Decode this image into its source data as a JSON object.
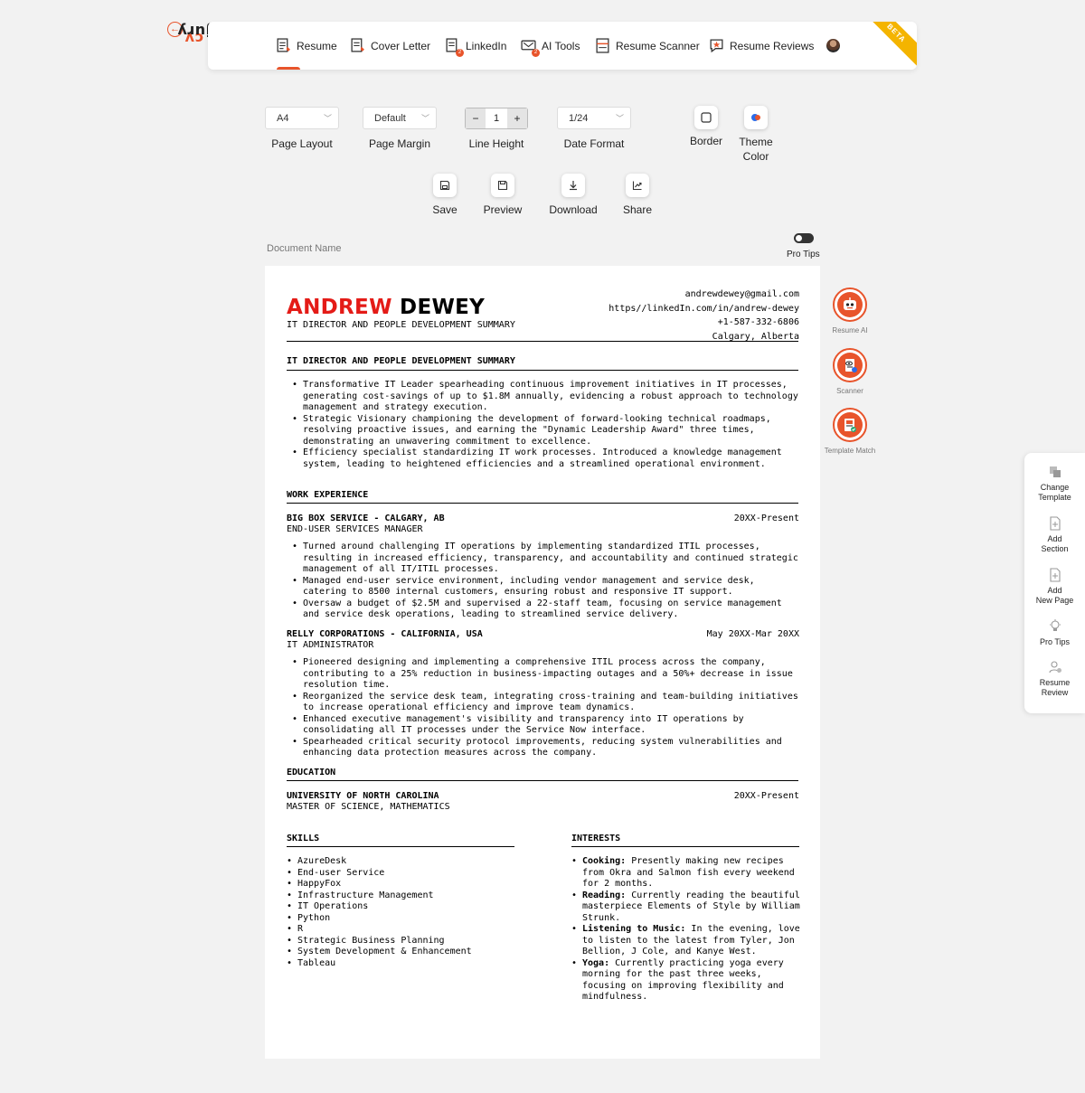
{
  "brand": {
    "cv": "cv",
    "jury": "jury",
    "accent": "#e8542b"
  },
  "nav": {
    "items": [
      {
        "label": "Resume",
        "icon": "resume-doc-icon"
      },
      {
        "label": "Cover Letter",
        "icon": "cover-letter-icon"
      },
      {
        "label": "LinkedIn",
        "icon": "linkedin-doc-icon",
        "badge": "2"
      },
      {
        "label": "AI Tools",
        "icon": "ai-tools-icon",
        "badge": "2"
      },
      {
        "label": "Resume Scanner",
        "icon": "scanner-icon"
      },
      {
        "label": "Resume Reviews",
        "icon": "review-star-icon"
      }
    ],
    "beta": "BETA"
  },
  "toolbar": {
    "page_layout": {
      "value": "A4",
      "label": "Page Layout"
    },
    "page_margin": {
      "value": "Default",
      "label": "Page Margin"
    },
    "line_height": {
      "value": "1",
      "minus": "−",
      "plus": "+",
      "label": "Line Height"
    },
    "date_format": {
      "value": "1/24",
      "label": "Date Format"
    },
    "border_label": "Border",
    "theme_label_1": "Theme",
    "theme_label_2": "Color",
    "save_label": "Save",
    "preview_label": "Preview",
    "download_label": "Download",
    "share_label": "Share"
  },
  "document_name_label": "Document Name",
  "pro_tips_toggle_label": "Pro Tips",
  "resume": {
    "first_name": "ANDREW",
    "last_name": "DEWEY",
    "subtitle": "IT DIRECTOR AND PEOPLE DEVELOPMENT SUMMARY",
    "contact": {
      "email": "andrewdewey@gmail.com",
      "linkedin": "https//linkedIn.com/in/andrew-dewey",
      "phone": "+1-587-332-6806",
      "location": "Calgary, Alberta"
    },
    "summary_title": "IT DIRECTOR AND PEOPLE DEVELOPMENT SUMMARY",
    "summary": [
      "Transformative IT Leader spearheading continuous improvement initiatives in IT processes, generating cost-savings of up to $1.8M annually, evidencing a robust approach to technology management and strategy execution.",
      "Strategic Visionary championing the development of forward-looking technical roadmaps, resolving proactive issues, and earning the \"Dynamic Leadership Award\" three times, demonstrating an unwavering commitment to excellence.",
      "Efficiency specialist standardizing IT work processes. Introduced a knowledge management system, leading to heightened efficiencies and a streamlined operational environment."
    ],
    "work_title": "WORK EXPERIENCE",
    "jobs": [
      {
        "company": "BIG BOX SERVICE - CALGARY, AB",
        "date": "20XX-Present",
        "role": "END-USER SERVICES MANAGER",
        "bullets": [
          "Turned around challenging IT operations by implementing standardized ITIL processes, resulting in increased efficiency, transparency, and accountability and continued strategic management of all IT/ITIL processes.",
          "Managed end-user service environment, including vendor management and service desk, catering to 8500 internal customers, ensuring robust and responsive IT support.",
          "Oversaw a budget of $2.5M and supervised a 22-staff team, focusing on service management and service desk operations, leading to streamlined service delivery."
        ]
      },
      {
        "company": "RELLY CORPORATIONS - CALIFORNIA, USA",
        "date": "May 20XX-Mar 20XX",
        "role": "IT ADMINISTRATOR",
        "bullets": [
          "Pioneered designing and implementing a comprehensive ITIL process across the company, contributing to a 25% reduction in business-impacting outages and a 50%+ decrease in issue resolution time.",
          "Reorganized the service desk team, integrating cross-training and team-building initiatives to increase operational efficiency and improve team dynamics.",
          "Enhanced executive management's visibility and transparency into IT operations by consolidating all IT processes under the Service Now interface.",
          "Spearheaded critical security protocol improvements, reducing system vulnerabilities and enhancing data protection measures across the company."
        ]
      }
    ],
    "education_title": "EDUCATION",
    "education": {
      "school": "UNIVERSITY OF NORTH CAROLINA",
      "date": "20XX-Present",
      "degree": "MASTER OF SCIENCE, MATHEMATICS"
    },
    "skills_title": "SKILLS",
    "skills": [
      "AzureDesk",
      "End-user Service",
      "HappyFox",
      "Infrastructure Management",
      "IT Operations",
      "Python",
      "R",
      "Strategic Business Planning",
      "System Development & Enhancement",
      "Tableau"
    ],
    "interests_title": "INTERESTS",
    "interests": [
      {
        "title": "Cooking:",
        "text": "Presently making new recipes from Okra and Salmon fish every weekend for 2 months."
      },
      {
        "title": "Reading:",
        "text": "Currently reading the beautiful masterpiece Elements of Style by William Strunk."
      },
      {
        "title": "Listening to Music:",
        "text": "In the evening, love to listen to the latest from Tyler, Jon Bellion, J Cole, and Kanye West."
      },
      {
        "title": "Yoga:",
        "text": "Currently practicing yoga every morning for the past three weeks, focusing on improving flexibility and mindfulness."
      }
    ]
  },
  "ai_tools": [
    {
      "label": "Resume AI",
      "icon": "robot-icon"
    },
    {
      "label": "Scanner",
      "icon": "scanner-eye-icon"
    },
    {
      "label": "Template Match",
      "icon": "template-match-icon"
    }
  ],
  "side_panel": {
    "change_template_1": "Change",
    "change_template_2": "Template",
    "add_section_1": "Add",
    "add_section_2": "Section",
    "add_page_1": "Add",
    "add_page_2": "New Page",
    "pro_tips": "Pro Tips",
    "resume_review_1": "Resume",
    "resume_review_2": "Review"
  }
}
